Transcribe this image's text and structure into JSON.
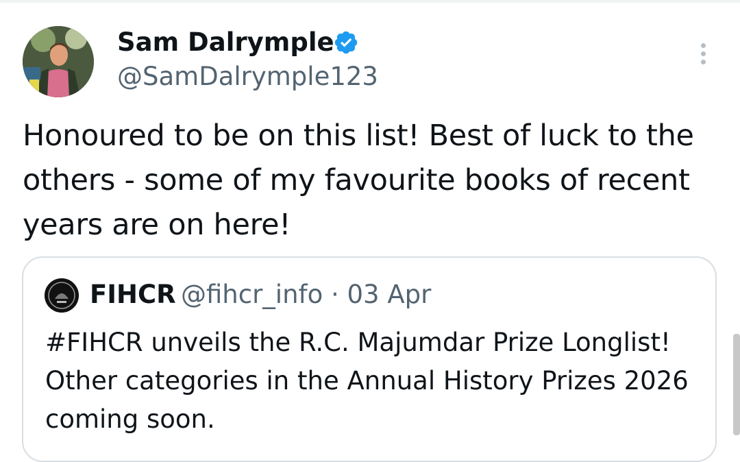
{
  "tweet": {
    "author_name": "Sam Dalrymple",
    "author_handle": "@SamDalrymple123",
    "verified": true,
    "text": "Honoured to be on this list! Best of luck to the others - some of my favourite books of recent years are on here!"
  },
  "quoted_tweet": {
    "author_name": "FIHCR",
    "author_handle": "@fihcr_info",
    "date": "· 03 Apr",
    "text": "#FIHCR unveils the R.C. Majumdar Prize Longlist! Other categories in the Annual History Prizes 2026 coming soon."
  },
  "icons": {
    "verified": "verified-badge-icon",
    "more": "more-options-icon"
  },
  "colors": {
    "verified": "#1d9bf0",
    "secondary_text": "#536471",
    "border": "#d8dee2"
  }
}
